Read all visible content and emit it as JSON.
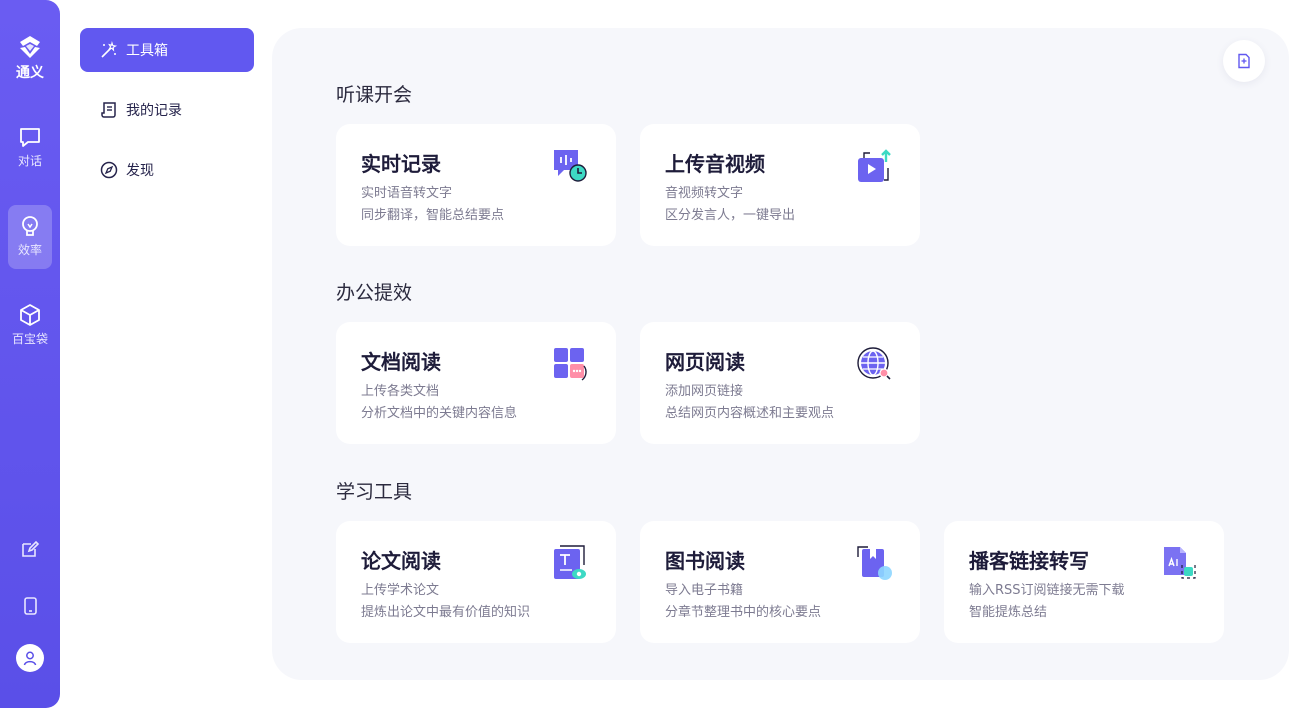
{
  "app": {
    "name": "通义"
  },
  "rail": {
    "items": [
      {
        "label": "对话",
        "icon": "chat-icon"
      },
      {
        "label": "效率",
        "icon": "lightbulb-icon"
      },
      {
        "label": "百宝袋",
        "icon": "cube-icon"
      }
    ],
    "bottom": [
      "edit-icon",
      "mobile-icon",
      "user-avatar-icon"
    ]
  },
  "subnav": {
    "items": [
      {
        "label": "工具箱",
        "icon": "magic-wand-icon"
      },
      {
        "label": "我的记录",
        "icon": "scroll-icon"
      },
      {
        "label": "发现",
        "icon": "compass-icon"
      }
    ]
  },
  "sections": [
    {
      "title": "听课开会",
      "cards": [
        {
          "title": "实时记录",
          "desc1": "实时语音转文字",
          "desc2": "同步翻译，智能总结要点",
          "icon": "realtime-record-icon"
        },
        {
          "title": "上传音视频",
          "desc1": "音视频转文字",
          "desc2": "区分发言人，一键导出",
          "icon": "upload-video-icon"
        }
      ]
    },
    {
      "title": "办公提效",
      "cards": [
        {
          "title": "文档阅读",
          "desc1": "上传各类文档",
          "desc2": "分析文档中的关键内容信息",
          "icon": "document-read-icon"
        },
        {
          "title": "网页阅读",
          "desc1": "添加网页链接",
          "desc2": "总结网页内容概述和主要观点",
          "icon": "web-read-icon"
        }
      ]
    },
    {
      "title": "学习工具",
      "cards": [
        {
          "title": "论文阅读",
          "desc1": "上传学术论文",
          "desc2": "提炼出论文中最有价值的知识",
          "icon": "paper-read-icon"
        },
        {
          "title": "图书阅读",
          "desc1": "导入电子书籍",
          "desc2": "分章节整理书中的核心要点",
          "icon": "book-read-icon"
        },
        {
          "title": "播客链接转写",
          "desc1": "输入RSS订阅链接无需下载",
          "desc2": "智能提炼总结",
          "icon": "podcast-transcribe-icon"
        }
      ]
    }
  ],
  "colors": {
    "accent": "#6158f0",
    "rail": "#5a4fe8",
    "mainBg": "#f6f7fb"
  }
}
